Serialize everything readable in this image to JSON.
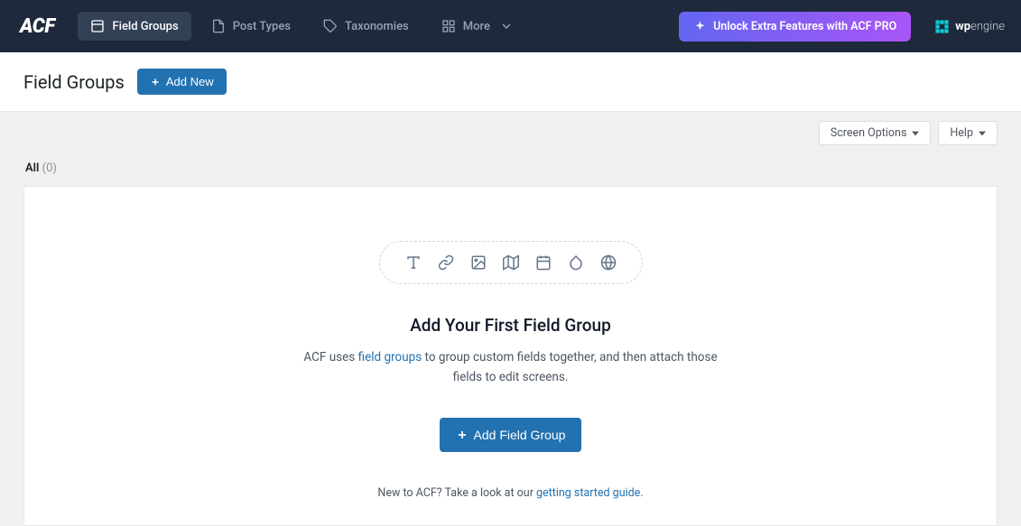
{
  "brand": "ACF",
  "nav": {
    "field_groups": "Field Groups",
    "post_types": "Post Types",
    "taxonomies": "Taxonomies",
    "more": "More"
  },
  "pro_cta": "Unlock Extra Features with ACF PRO",
  "wpengine_prefix": "wp",
  "wpengine_suffix": "engine",
  "page": {
    "title": "Field Groups",
    "add_new": "Add New"
  },
  "meta": {
    "screen_options": "Screen Options",
    "help": "Help"
  },
  "filter": {
    "all": "All",
    "count": "(0)"
  },
  "empty": {
    "title": "Add Your First Field Group",
    "desc_pre": "ACF uses ",
    "desc_link": "field groups",
    "desc_post": " to group custom fields together, and then attach those fields to edit screens.",
    "button": "Add Field Group",
    "footer_pre": "New to ACF? Take a look at our ",
    "footer_link": "getting started guide",
    "footer_post": "."
  }
}
